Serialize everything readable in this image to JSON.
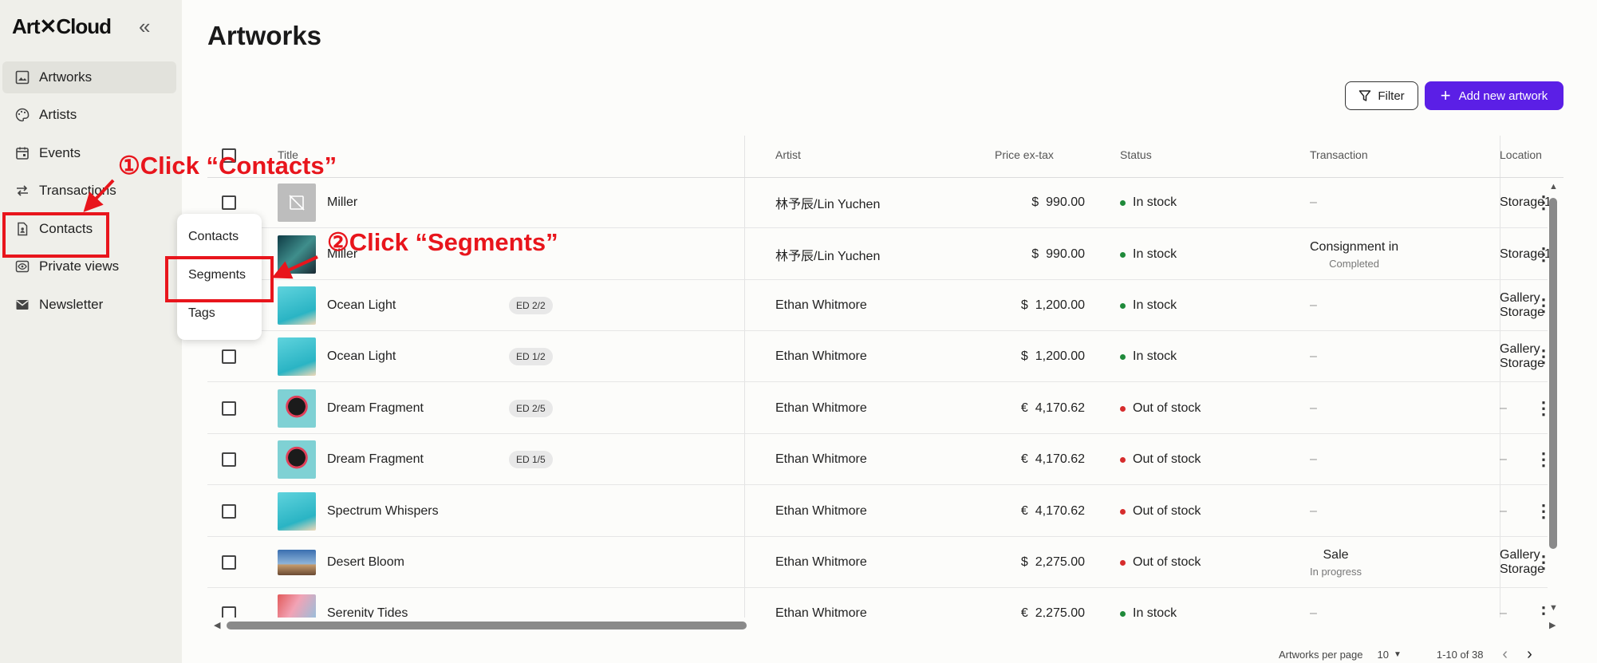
{
  "app": {
    "logo": "Art✕Cloud",
    "collapse_icon": "«"
  },
  "sidebar": {
    "items": [
      {
        "label": "Artworks",
        "icon": "image-icon"
      },
      {
        "label": "Artists",
        "icon": "palette-icon"
      },
      {
        "label": "Events",
        "icon": "calendar-icon"
      },
      {
        "label": "Transactions",
        "icon": "arrows-icon"
      },
      {
        "label": "Contacts",
        "icon": "contact-icon"
      },
      {
        "label": "Private views",
        "icon": "eye-icon"
      },
      {
        "label": "Newsletter",
        "icon": "mail-icon"
      }
    ]
  },
  "header": {
    "title": "Artworks",
    "filter_label": "Filter",
    "add_label": "Add new artwork"
  },
  "table": {
    "columns": [
      "Title",
      "Artist",
      "Price ex-tax",
      "Status",
      "Transaction",
      "Location"
    ],
    "rows": [
      {
        "title": "Miller",
        "edition": "",
        "artist": "林予辰/Lin Yuchen",
        "currency": "$",
        "price": "990.00",
        "status": "In stock",
        "status_color": "#1f8a3a",
        "transaction": "–",
        "transaction_sub": "",
        "location": "Storage1"
      },
      {
        "title": "Miller",
        "edition": "",
        "artist": "林予辰/Lin Yuchen",
        "currency": "$",
        "price": "990.00",
        "status": "In stock",
        "status_color": "#1f8a3a",
        "transaction": "Consignment in",
        "transaction_sub": "Completed",
        "location": "Storage1"
      },
      {
        "title": "Ocean Light",
        "edition": "ED 2/2",
        "artist": "Ethan Whitmore",
        "currency": "$",
        "price": "1,200.00",
        "status": "In stock",
        "status_color": "#1f8a3a",
        "transaction": "–",
        "transaction_sub": "",
        "location": "Gallery Storage"
      },
      {
        "title": "Ocean Light",
        "edition": "ED 1/2",
        "artist": "Ethan Whitmore",
        "currency": "$",
        "price": "1,200.00",
        "status": "In stock",
        "status_color": "#1f8a3a",
        "transaction": "–",
        "transaction_sub": "",
        "location": "Gallery Storage"
      },
      {
        "title": "Dream Fragment",
        "edition": "ED 2/5",
        "artist": "Ethan Whitmore",
        "currency": "€",
        "price": "4,170.62",
        "status": "Out of stock",
        "status_color": "#d62c2c",
        "transaction": "–",
        "transaction_sub": "",
        "location": "–"
      },
      {
        "title": "Dream Fragment",
        "edition": "ED 1/5",
        "artist": "Ethan Whitmore",
        "currency": "€",
        "price": "4,170.62",
        "status": "Out of stock",
        "status_color": "#d62c2c",
        "transaction": "–",
        "transaction_sub": "",
        "location": "–"
      },
      {
        "title": "Spectrum Whispers",
        "edition": "",
        "artist": "Ethan Whitmore",
        "currency": "€",
        "price": "4,170.62",
        "status": "Out of stock",
        "status_color": "#d62c2c",
        "transaction": "–",
        "transaction_sub": "",
        "location": "–"
      },
      {
        "title": "Desert Bloom",
        "edition": "",
        "artist": "Ethan Whitmore",
        "currency": "$",
        "price": "2,275.00",
        "status": "Out of stock",
        "status_color": "#d62c2c",
        "transaction": "Sale",
        "transaction_sub": "In progress",
        "location": "Gallery Storage"
      },
      {
        "title": "Serenity Tides",
        "edition": "",
        "artist": "Ethan Whitmore",
        "currency": "€",
        "price": "2,275.00",
        "status": "In stock",
        "status_color": "#1f8a3a",
        "transaction": "–",
        "transaction_sub": "",
        "location": "–"
      }
    ]
  },
  "pagination": {
    "per_page_label": "Artworks per page",
    "per_page_value": "10",
    "range": "1-10 of 38"
  },
  "popup": {
    "items": [
      "Contacts",
      "Segments",
      "Tags"
    ]
  },
  "annotations": {
    "step1": "①Click “Contacts”",
    "step2": "②Click “Segments”",
    "color": "#e8151c"
  },
  "colors": {
    "accent": "#5b1fe6",
    "in_stock": "#1f8a3a",
    "out_of_stock": "#d62c2c"
  }
}
